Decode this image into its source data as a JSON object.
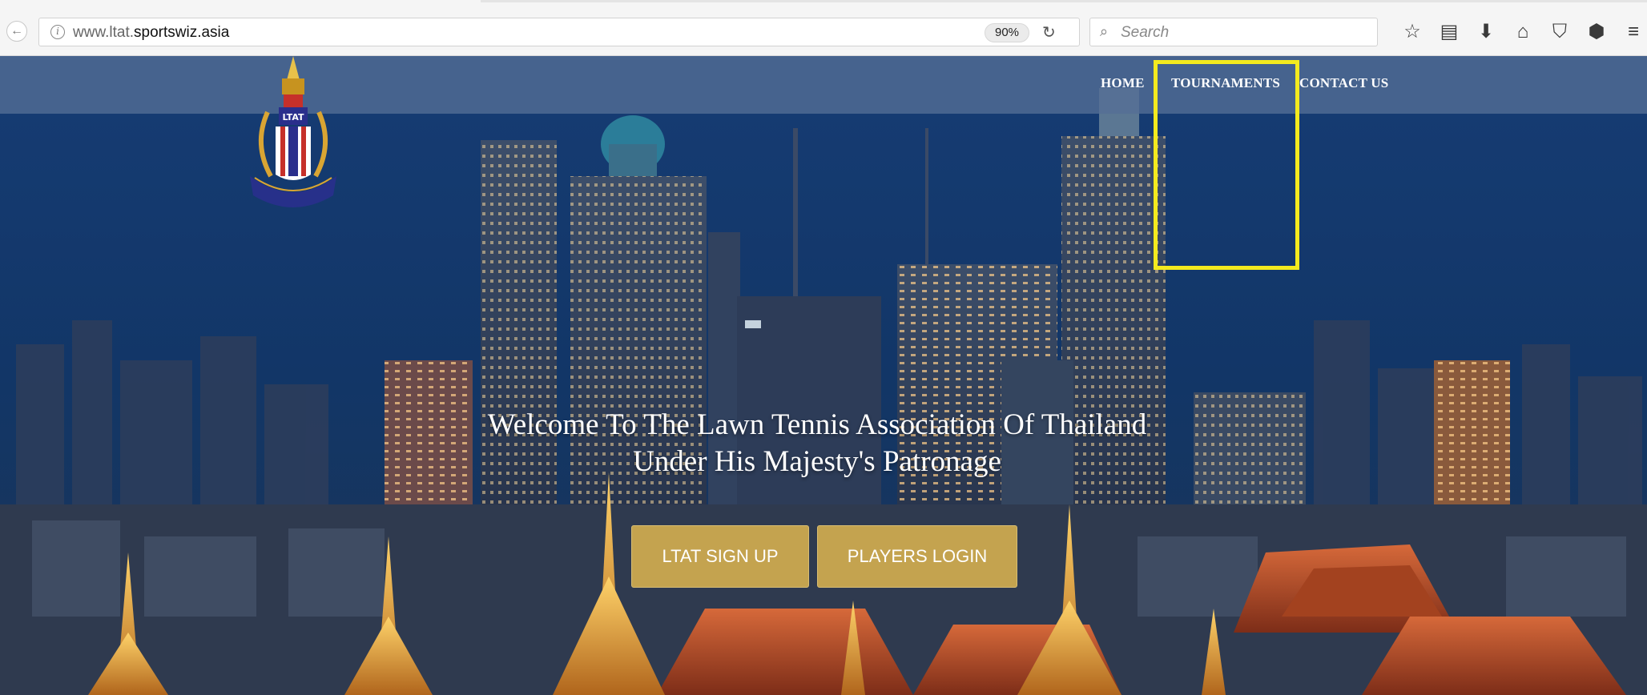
{
  "browser": {
    "url_prefix": "www.ltat.",
    "url_domain": "sportswiz.asia",
    "zoom": "90%",
    "search_placeholder": "Search",
    "icons": [
      "back-icon",
      "info-icon",
      "reload-icon",
      "search-icon",
      "bookmark-star-icon",
      "reading-list-icon",
      "download-icon",
      "home-icon",
      "pocket-icon",
      "extension-icon",
      "menu-icon"
    ]
  },
  "nav": {
    "home": "HOME",
    "tournaments": "TOURNAMENTS",
    "contact": "CONTACT US"
  },
  "hero": {
    "line1": "Welcome To The Lawn Tennis Association Of Thailand",
    "line2": "Under His Majesty's Patronage"
  },
  "buttons": {
    "signup": "LTAT SIGN UP",
    "login": "PLAYERS LOGIN"
  },
  "logo": {
    "label": "LTAT"
  },
  "colors": {
    "highlight": "#f4ea1e",
    "button": "#c4a34f",
    "header_band": "#546e96"
  }
}
